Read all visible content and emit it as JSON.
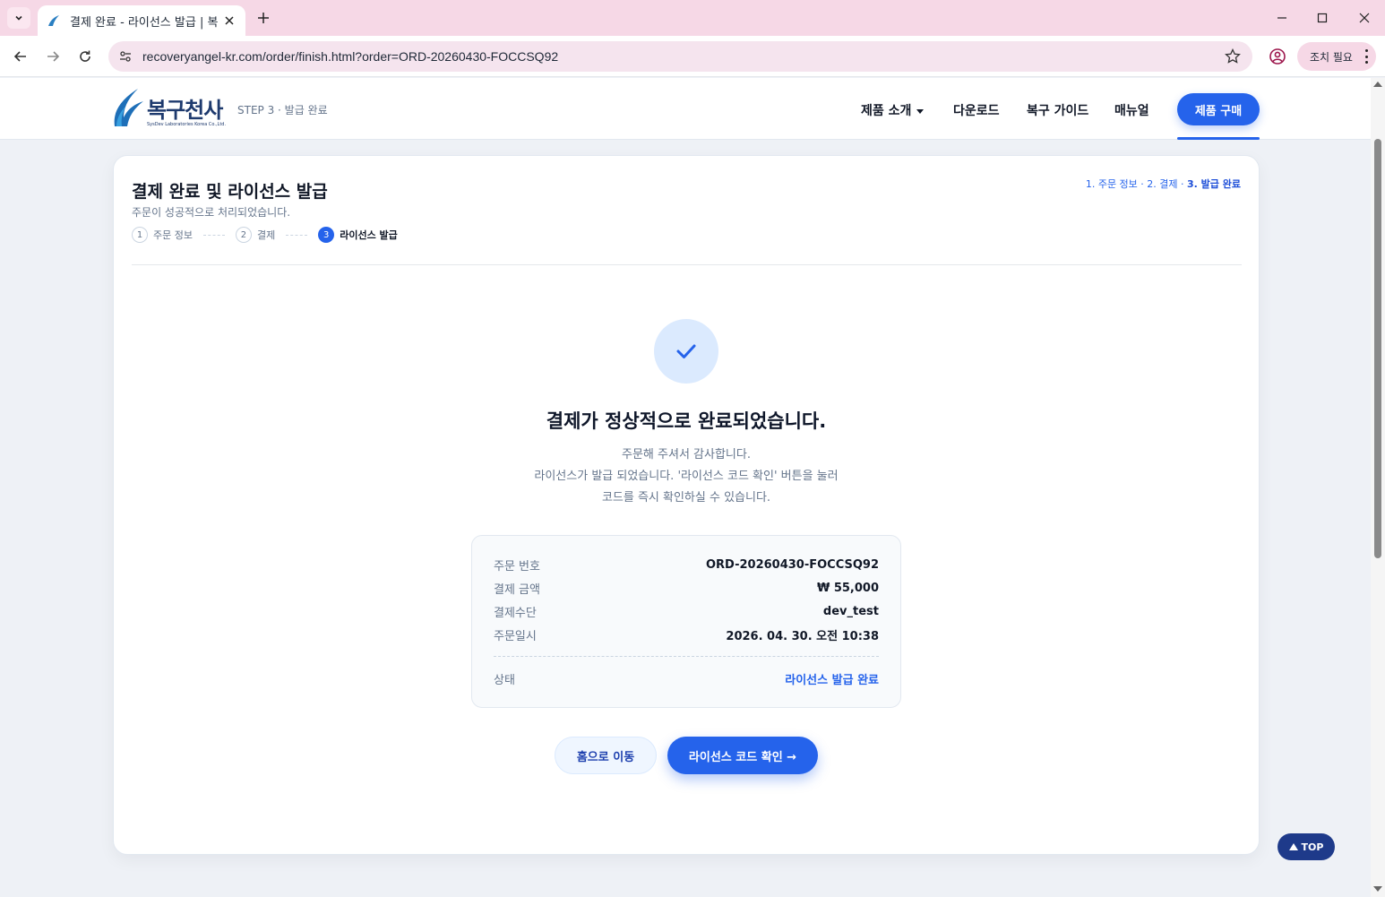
{
  "browser": {
    "tab_title": "결제 완료 - 라이선스 발급 | 복",
    "url": "recoveryangel-kr.com/order/finish.html?order=ORD-20260430-FOCCSQ92",
    "action_label": "조치 필요"
  },
  "site": {
    "logo_text": "복구천사",
    "logo_sub": "SysDev Laboratories Korea Co.,Ltd.",
    "step_label": "STEP 3 · 발급 완료",
    "nav": [
      "제품 소개",
      "다운로드",
      "복구 가이드",
      "매뉴얼"
    ],
    "buy_label": "제품 구매",
    "brand_color": "#2563eb"
  },
  "card": {
    "title": "결제 완료 및 라이선스 발급",
    "subtitle": "주문이 성공적으로 처리되었습니다.",
    "crumb_prefix": "1. 주문 정보 · 2. 결제 · ",
    "crumb_current": "3. 발급 완료",
    "steps": [
      {
        "num": "1",
        "label": "주문 정보"
      },
      {
        "num": "2",
        "label": "결제"
      },
      {
        "num": "3",
        "label": "라이선스 발급"
      }
    ],
    "done_title": "결제가 정상적으로 완료되었습니다.",
    "done_line1": "주문해 주셔서 감사합니다.",
    "done_line2": "라이선스가 발급 되었습니다. '라이선스 코드 확인' 버튼을 눌러",
    "done_line3": "코드를 즉시 확인하실 수 있습니다.",
    "summary": {
      "order_no_label": "주문 번호",
      "order_no": "ORD-20260430-FOCCSQ92",
      "amount_label": "결제 금액",
      "amount": "₩ 55,000",
      "method_label": "결제수단",
      "method": "dev_test",
      "date_label": "주문일시",
      "date": "2026. 04. 30. 오전 10:38",
      "status_label": "상태",
      "status": "라이선스 발급 완료"
    },
    "home_button": "홈으로 이동",
    "license_button": "라이선스 코드 확인 →"
  },
  "top_button": "TOP"
}
